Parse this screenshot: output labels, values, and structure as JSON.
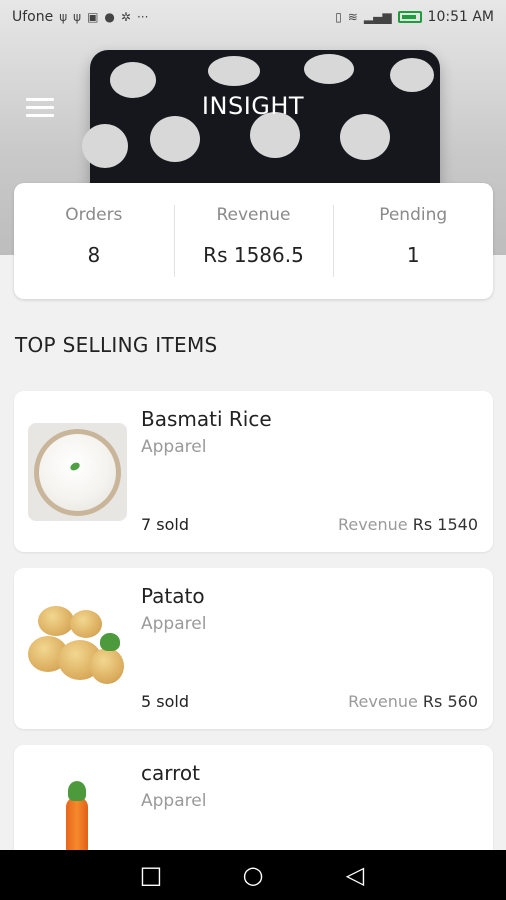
{
  "status_bar": {
    "carrier": "Ufone",
    "time": "10:51 AM",
    "left_icons": [
      "usb-icon",
      "usb-icon",
      "notification-icon",
      "vpn-icon",
      "settings-icon"
    ],
    "more": "···",
    "right_icons": [
      "vibrate-icon",
      "wifi-icon",
      "signal-icon",
      "battery-icon"
    ]
  },
  "header": {
    "title": "INSIGHT",
    "menu_icon": "hamburger-menu-icon"
  },
  "stats": [
    {
      "label": "Orders",
      "value": "8"
    },
    {
      "label": "Revenue",
      "value": "Rs 1586.5"
    },
    {
      "label": "Pending",
      "value": "1"
    }
  ],
  "section_title": "TOP SELLING ITEMS",
  "items": [
    {
      "name": "Basmati Rice",
      "category": "Apparel",
      "sold": "7 sold",
      "revenue_label": "Revenue",
      "revenue_value": "Rs 1540"
    },
    {
      "name": "Patato",
      "category": "Apparel",
      "sold": "5 sold",
      "revenue_label": "Revenue",
      "revenue_value": "Rs 560"
    },
    {
      "name": "carrot",
      "category": "Apparel"
    }
  ],
  "nav": {
    "recents": "□",
    "home": "○",
    "back": "◁"
  },
  "colors": {
    "card": "#ffffff",
    "background": "#f1f1f1",
    "muted_text": "#9a9a9a",
    "nav_bar": "#000000"
  }
}
